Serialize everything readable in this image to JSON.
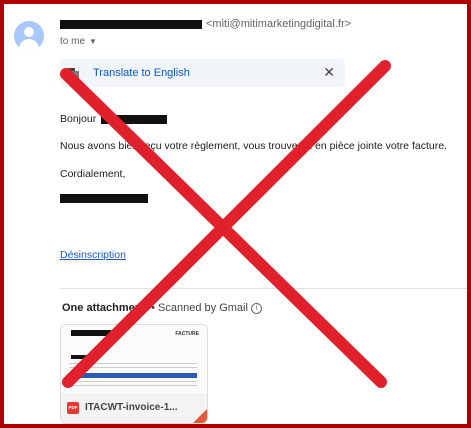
{
  "header": {
    "sender_email": "<miti@mitimarketingdigital.fr>",
    "to_label": "to me"
  },
  "translate": {
    "label": "Translate to English",
    "close": "✕"
  },
  "body": {
    "greeting": "Bonjour",
    "message": "Nous avons bien reçu votre règlement, vous trouverez en pièce jointe votre facture.",
    "closing": "Cordialement,"
  },
  "unsubscribe": "Désinscription",
  "attachments": {
    "title": "One attachment",
    "scanned": "• Scanned by Gmail",
    "info": "i",
    "file_name": "ITACWT-invoice-1...",
    "file_type": "PDF",
    "thumb_label": "FACTURE"
  },
  "colors": {
    "border": "#b00000",
    "cross": "#e0212b",
    "link": "#1a57c9"
  }
}
